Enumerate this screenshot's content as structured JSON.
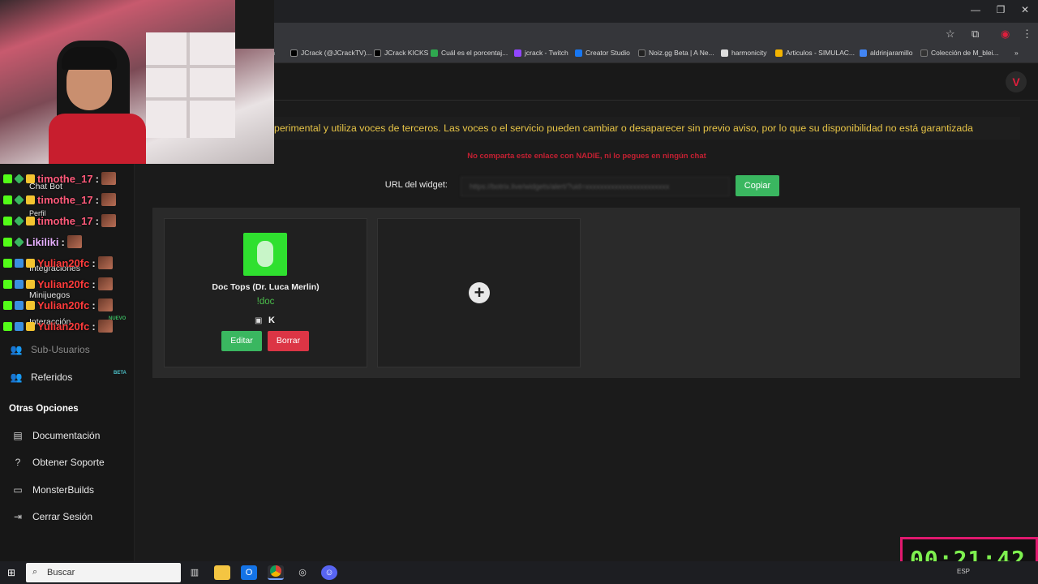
{
  "browser": {
    "window_controls": [
      "—",
      "❐",
      "✕"
    ],
    "bookmarks": [
      {
        "label": "ch",
        "color": "#6a6a6a"
      },
      {
        "label": "JCrack (@JCrackTV)...",
        "color": "#000000"
      },
      {
        "label": "JCrack KICKS",
        "color": "#000000"
      },
      {
        "label": "Cuál es el porcentaj...",
        "color": "#2fa84f"
      },
      {
        "label": "jcrack - Twitch",
        "color": "#9146ff"
      },
      {
        "label": "Creator Studio",
        "color": "#1877f2"
      },
      {
        "label": "Noiz.gg Beta | A Ne...",
        "color": "#222222"
      },
      {
        "label": "harmonicity",
        "color": "#dddddd"
      },
      {
        "label": "Articulos - SIMULAC...",
        "color": "#f4b400"
      },
      {
        "label": "aldrinjaramillo",
        "color": "#4285f4"
      },
      {
        "label": "Colección de M_blei...",
        "color": "#333333"
      }
    ],
    "more_bookmarks": "»"
  },
  "app": {
    "logo_letter": "V"
  },
  "chat": [
    {
      "user": "timothe_17",
      "color": "#ff5a7a"
    },
    {
      "user": "timothe_17",
      "color": "#ff5a7a"
    },
    {
      "user": "timothe_17",
      "color": "#ff5a7a"
    },
    {
      "user": "Likiliki",
      "color": "#e7b0ff"
    },
    {
      "user": "Yulian20fc",
      "color": "#ff3b3b"
    },
    {
      "user": "Yulian20fc",
      "color": "#ff3b3b"
    },
    {
      "user": "Yulian20fc",
      "color": "#ff3b3b"
    },
    {
      "user": "Yulian20fc",
      "color": "#ff3b3b"
    }
  ],
  "chat_colon": ":",
  "sidebar": {
    "hidden_items": [
      "Chat Bot",
      "Perfil",
      "Integraciones",
      "Minijuegos",
      "Interacción"
    ],
    "new_tag": "NUEVO",
    "items": [
      {
        "label": "Sub-Usuarios",
        "icon": "users-icon",
        "dim": true
      },
      {
        "label": "Referidos",
        "icon": "user-group-icon",
        "tag": "BETA"
      }
    ],
    "section_title": "Otras Opciones",
    "other_items": [
      {
        "label": "Documentación",
        "icon": "doc-icon"
      },
      {
        "label": "Obtener Soporte",
        "icon": "help-icon"
      },
      {
        "label": "MonsterBuilds",
        "icon": "monitor-icon"
      },
      {
        "label": "Cerrar Sesión",
        "icon": "logout-icon"
      }
    ]
  },
  "main": {
    "warning": "perimental y utiliza voces de terceros. Las voces o el servicio pueden cambiar o desaparecer sin previo aviso, por lo que su disponibilidad no está garantizada",
    "share_alert": "No comparta este enlace con NADIE, ni lo pegues en ningún chat",
    "url_label": "URL del widget:",
    "url_value": "https://botrix.live/widgets/alert/?uid=xxxxxxxxxxxxxxxxxxxxxxx",
    "copy_label": "Copiar",
    "card": {
      "title": "Doc Tops (Dr. Luca Merlin)",
      "command": "!doc",
      "edit_label": "Editar",
      "delete_label": "Borrar"
    },
    "add_symbol": "+"
  },
  "timer": "00:21:42",
  "taskbar": {
    "search_placeholder": "Buscar",
    "tray_lang": "ESP"
  }
}
